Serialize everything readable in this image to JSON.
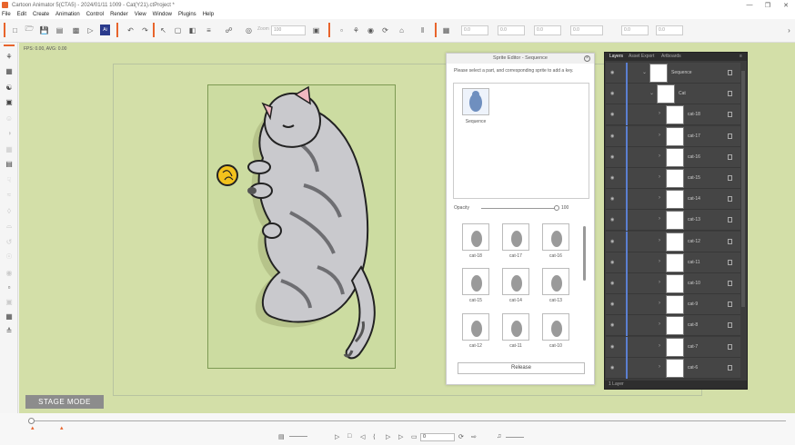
{
  "window": {
    "title": "Cartoon Animator 5(CTA5) - 2024/01/11 1009 - Cat(Y21).ctProject *",
    "controls": [
      "—",
      "❐",
      "✕"
    ]
  },
  "menu": [
    "File",
    "Edit",
    "Create",
    "Animation",
    "Control",
    "Render",
    "View",
    "Window",
    "Plugins",
    "Help"
  ],
  "toolbar": {
    "zoom_label": "Zoom",
    "zoom_value": "100",
    "fields": [
      "0.0",
      "0.0",
      "0.0",
      "0.0",
      "0.0",
      "0.0"
    ]
  },
  "stage": {
    "fps_text": "FPS: 0.00, AVG: 0.00",
    "mode_label": "STAGE MODE"
  },
  "sprite_editor": {
    "title": "Sprite Editor - Sequence",
    "hint": "Please select a part, and corresponding sprite to add a key.",
    "sequence_label": "Sequence",
    "opacity_label": "Opacity",
    "opacity_value": "100",
    "release_label": "Release",
    "sprites": [
      "cat-18",
      "cat-17",
      "cat-16",
      "cat-15",
      "cat-14",
      "cat-13",
      "cat-12",
      "cat-11",
      "cat-10"
    ]
  },
  "layers": {
    "tabs": [
      "Layers",
      "Asset Export",
      "Artboards"
    ],
    "items": [
      {
        "name": "Sequence",
        "indent": 0
      },
      {
        "name": "Cat",
        "indent": 1
      },
      {
        "name": "cat-18",
        "indent": 2
      },
      {
        "name": "cat-17",
        "indent": 2
      },
      {
        "name": "cat-16",
        "indent": 2
      },
      {
        "name": "cat-15",
        "indent": 2
      },
      {
        "name": "cat-14",
        "indent": 2
      },
      {
        "name": "cat-13",
        "indent": 2
      },
      {
        "name": "cat-12",
        "indent": 2
      },
      {
        "name": "cat-11",
        "indent": 2
      },
      {
        "name": "cat-10",
        "indent": 2
      },
      {
        "name": "cat-9",
        "indent": 2
      },
      {
        "name": "cat-8",
        "indent": 2
      },
      {
        "name": "cat-7",
        "indent": 2
      },
      {
        "name": "cat-6",
        "indent": 2
      }
    ],
    "footer": "1 Layer"
  },
  "timeline": {
    "frame_value": "0"
  },
  "colors": {
    "accent": "#e8642c",
    "stage_bg": "#d3dfa8",
    "canvas_bg": "#ccdca1",
    "layer_line": "#5b7fd0"
  }
}
